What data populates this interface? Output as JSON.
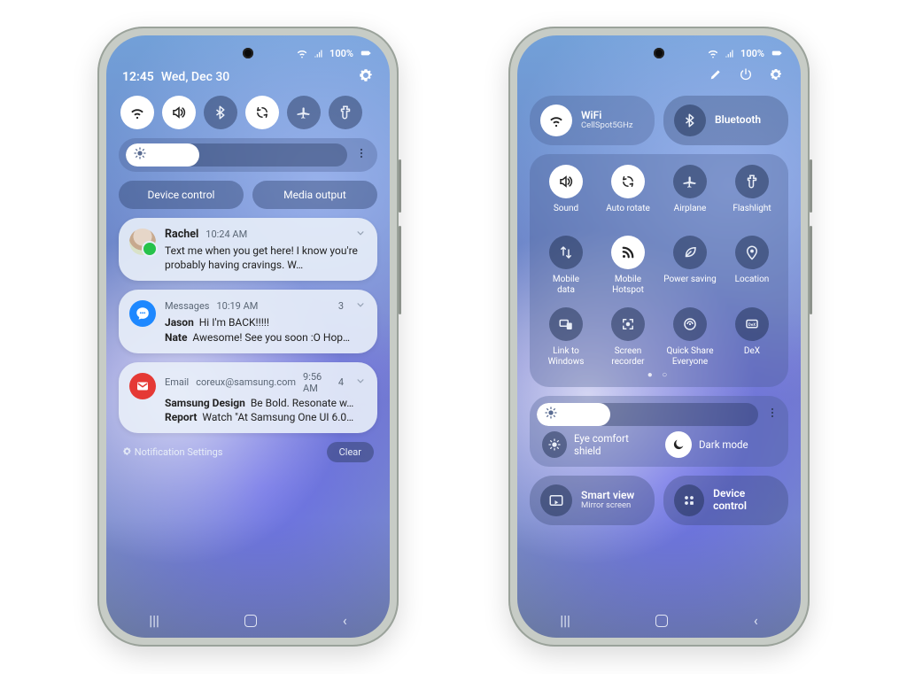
{
  "status": {
    "battery": "100%"
  },
  "left": {
    "header": {
      "time": "12:45",
      "date": "Wed, Dec 30"
    },
    "quick_toggles": [
      {
        "name": "wifi-icon",
        "on": true
      },
      {
        "name": "sound-icon",
        "on": true
      },
      {
        "name": "bluetooth-icon",
        "on": false
      },
      {
        "name": "rotate-icon",
        "on": true
      },
      {
        "name": "airplane-icon",
        "on": false
      },
      {
        "name": "flashlight-icon",
        "on": false
      }
    ],
    "brightness_pct": 33,
    "buttons": {
      "device_control": "Device control",
      "media_output": "Media output"
    },
    "notifications": [
      {
        "sender": "Rachel",
        "time": "10:24 AM",
        "body": "Text me when you get here! I know you're probably having cravings. W…"
      },
      {
        "app": "Messages",
        "time": "10:19 AM",
        "count": "3",
        "lines": [
          {
            "name": "Jason",
            "text": "Hi I'm BACK!!!!!"
          },
          {
            "name": "Nate",
            "text": "Awesome! See you soon :O Hop…"
          }
        ]
      },
      {
        "app": "Email",
        "addr": "coreux@samsung.com",
        "time": "9:56 AM",
        "count": "4",
        "lines": [
          {
            "name": "Samsung Design",
            "text": "Be Bold. Resonate w…"
          },
          {
            "name": "Report",
            "text": "Watch \"At Samsung One UI 6.0…"
          }
        ]
      }
    ],
    "footer": {
      "settings": "Notification Settings",
      "clear": "Clear"
    }
  },
  "right": {
    "big_tiles": {
      "wifi": {
        "title": "WiFi",
        "sub": "CellSpot5GHz",
        "on": true
      },
      "bluetooth": {
        "title": "Bluetooth",
        "on": false
      }
    },
    "grid": [
      {
        "name": "sound-icon",
        "label": "Sound",
        "on": true
      },
      {
        "name": "rotate-icon",
        "label": "Auto rotate",
        "on": true
      },
      {
        "name": "airplane-icon",
        "label": "Airplane",
        "on": false
      },
      {
        "name": "flashlight-icon",
        "label": "Flashlight",
        "on": false
      },
      {
        "name": "mobiledata-icon",
        "label": "Mobile\ndata",
        "on": false
      },
      {
        "name": "hotspot-icon",
        "label": "Mobile\nHotspot",
        "on": true
      },
      {
        "name": "powersave-icon",
        "label": "Power saving",
        "on": false
      },
      {
        "name": "location-icon",
        "label": "Location",
        "on": false
      },
      {
        "name": "link-icon",
        "label": "Link to\nWindows",
        "on": false
      },
      {
        "name": "screenrec-icon",
        "label": "Screen\nrecorder",
        "on": false
      },
      {
        "name": "quickshare-icon",
        "label": "Quick Share\nEveryone",
        "on": false
      },
      {
        "name": "dex-icon",
        "label": "DeX",
        "on": false
      }
    ],
    "brightness_pct": 33,
    "modes": {
      "eye": "Eye comfort shield",
      "dark": "Dark mode"
    },
    "bottom_tiles": {
      "smartview": {
        "title": "Smart view",
        "sub": "Mirror screen"
      },
      "devicecontrol": {
        "title": "Device control"
      }
    }
  }
}
